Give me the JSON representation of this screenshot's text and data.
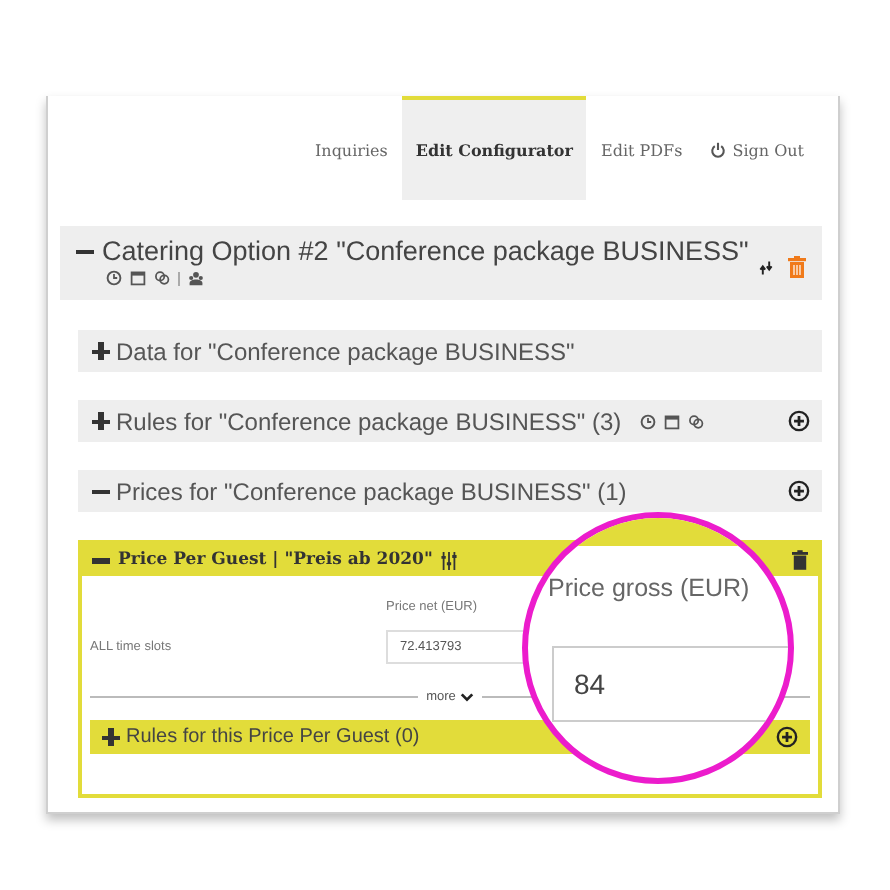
{
  "nav": {
    "tabs": [
      {
        "label": "Inquiries",
        "selected": false,
        "kind": "link"
      },
      {
        "label": "Edit Configurator",
        "selected": true,
        "kind": "link"
      },
      {
        "label": "Edit PDFs",
        "selected": false,
        "kind": "link"
      },
      {
        "label": "Sign Out",
        "selected": false,
        "kind": "signout"
      }
    ]
  },
  "option": {
    "title": "Catering Option #2 \"Conference package BUSINESS\"",
    "expanded": true
  },
  "sections": [
    {
      "title": "Data for \"Conference package BUSINESS\"",
      "expanded": false,
      "rule_icons": false,
      "add": false
    },
    {
      "title": "Rules for \"Conference package BUSINESS\" (3)",
      "expanded": false,
      "rule_icons": true,
      "add": true
    },
    {
      "title": "Prices for \"Conference package BUSINESS\" (1)",
      "expanded": true,
      "rule_icons": false,
      "add": true
    }
  ],
  "price": {
    "title": "Price Per Guest | \"Preis ab 2020\"",
    "expanded": true,
    "net_label": "Price net (EUR)",
    "row_label": "ALL time slots",
    "net_value": "72.413793",
    "more": "more",
    "rules": {
      "title": "Rules for this Price Per Guest (0)",
      "expanded": false
    }
  },
  "magnifier": {
    "label": "Price gross (EUR)",
    "value": "84"
  }
}
